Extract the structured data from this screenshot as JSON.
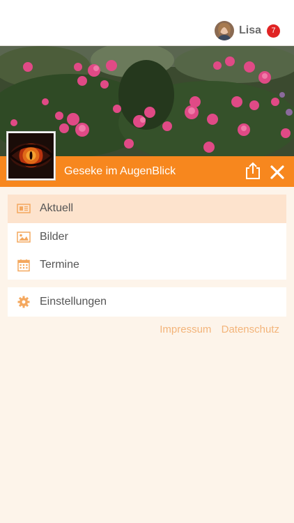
{
  "user": {
    "name": "Lisa",
    "badge_count": "7"
  },
  "header": {
    "title": "Geseke im AugenBlick",
    "share_icon": "share-icon",
    "close_icon": "close-icon"
  },
  "menu": {
    "groups": [
      {
        "items": [
          {
            "label": "Aktuell",
            "icon": "news-icon",
            "active": true
          },
          {
            "label": "Bilder",
            "icon": "image-icon",
            "active": false
          },
          {
            "label": "Termine",
            "icon": "calendar-icon",
            "active": false
          }
        ]
      },
      {
        "items": [
          {
            "label": "Einstellungen",
            "icon": "gear-icon",
            "active": false
          }
        ]
      }
    ]
  },
  "footer_links": {
    "impressum": "Impressum",
    "datenschutz": "Datenschutz"
  },
  "colors": {
    "accent": "#f7871e",
    "active_bg": "#fde3cd",
    "page_bg": "#fdf4ea",
    "badge": "#e02323",
    "link": "#f3b47a",
    "icon": "#f4a85f"
  }
}
